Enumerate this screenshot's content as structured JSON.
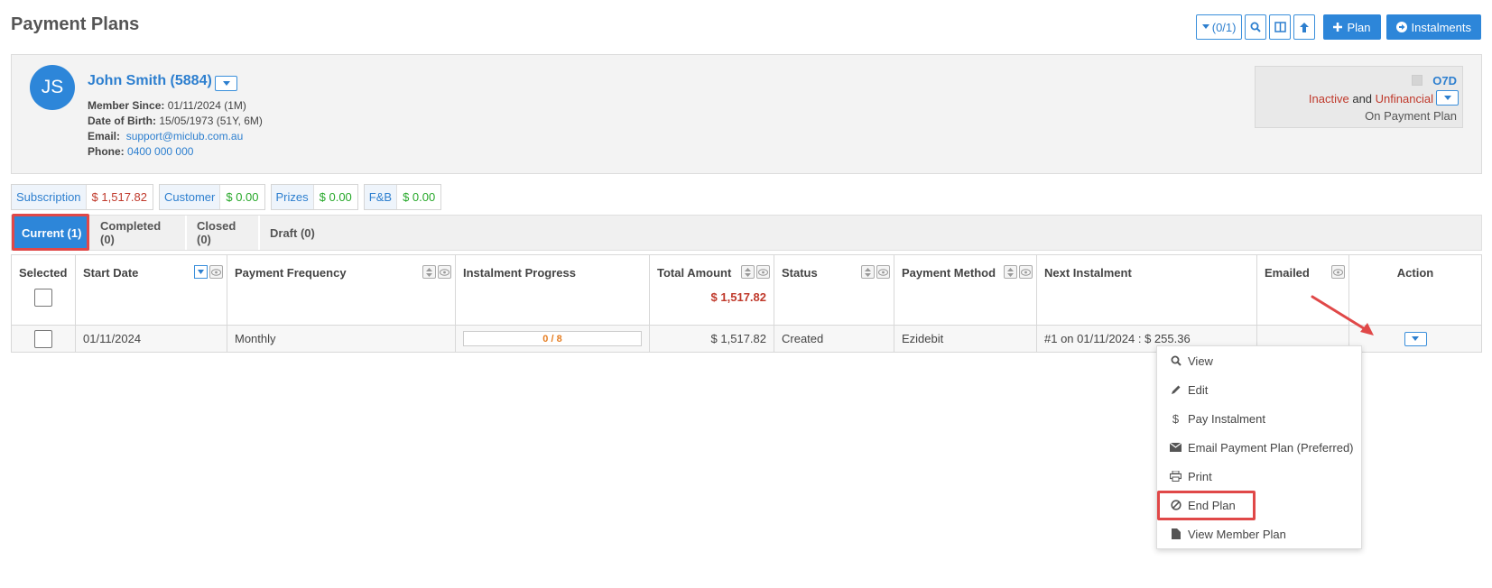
{
  "page": {
    "title": "Payment Plans"
  },
  "toolbar": {
    "filter_label": "(0/1)",
    "plan_label": "Plan",
    "instalments_label": "Instalments"
  },
  "member": {
    "initials": "JS",
    "name": "John Smith (5884)",
    "member_since_label": "Member Since:",
    "member_since": "01/11/2024 (1M)",
    "dob_label": "Date of Birth:",
    "dob": "15/05/1973 (51Y, 6M)",
    "email_label": "Email:",
    "email": "support@miclub.com.au",
    "phone_label": "Phone:",
    "phone": "0400 000 000",
    "code": "O7D",
    "status_inactive": "Inactive",
    "status_and": "and",
    "status_unfinancial": "Unfinancial",
    "on_plan": "On Payment Plan"
  },
  "balances": [
    {
      "label": "Subscription",
      "value": "$ 1,517.82",
      "tone": "red"
    },
    {
      "label": "Customer",
      "value": "$ 0.00",
      "tone": "green"
    },
    {
      "label": "Prizes",
      "value": "$ 0.00",
      "tone": "green"
    },
    {
      "label": "F&B",
      "value": "$ 0.00",
      "tone": "green"
    }
  ],
  "tabs": [
    "Current (1)",
    "Completed (0)",
    "Closed (0)",
    "Draft (0)"
  ],
  "columns": {
    "selected": "Selected",
    "start_date": "Start Date",
    "payment_frequency": "Payment Frequency",
    "instalment_progress": "Instalment Progress",
    "total_amount": "Total Amount",
    "total_sum": "$ 1,517.82",
    "status": "Status",
    "payment_method": "Payment Method",
    "next_instalment": "Next Instalment",
    "emailed": "Emailed",
    "action": "Action"
  },
  "row": {
    "start_date": "01/11/2024",
    "payment_frequency": "Monthly",
    "instalment_progress": "0 / 8",
    "total_amount": "$ 1,517.82",
    "status": "Created",
    "payment_method": "Ezidebit",
    "next_instalment": "#1 on 01/11/2024 : $ 255.36",
    "emailed": ""
  },
  "action_menu": [
    {
      "label": "View",
      "icon": "search-icon"
    },
    {
      "label": "Edit",
      "icon": "pencil-icon"
    },
    {
      "label": "Pay Instalment",
      "icon": "dollar-icon"
    },
    {
      "label": "Email Payment Plan (Preferred)",
      "icon": "envelope-icon"
    },
    {
      "label": "Print",
      "icon": "printer-icon"
    },
    {
      "label": "End Plan",
      "icon": "ban-icon"
    },
    {
      "label": "View Member Plan",
      "icon": "file-icon"
    }
  ],
  "colors": {
    "accent": "#2d86d9",
    "highlight": "#e04848",
    "red": "#c0392b",
    "green": "#27a82a"
  }
}
